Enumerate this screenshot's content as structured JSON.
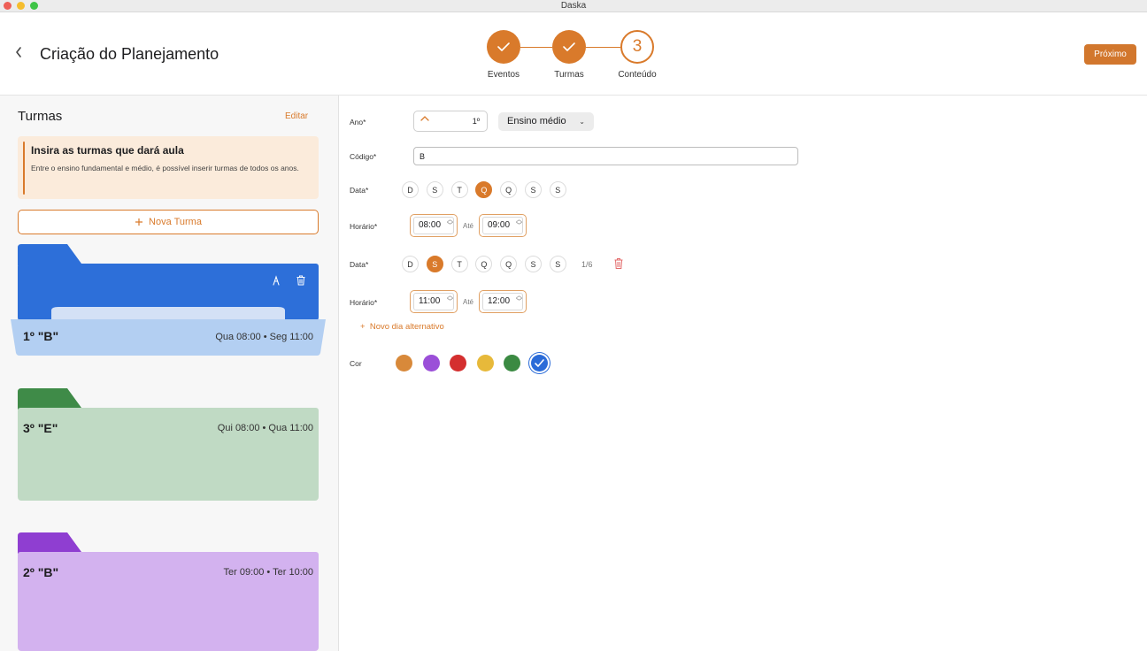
{
  "window": {
    "title": "Daska"
  },
  "header": {
    "back_icon": "chevron-left-icon",
    "title": "Criação do Planejamento",
    "steps": [
      {
        "label": "Eventos",
        "status": "done",
        "icon": "check-icon"
      },
      {
        "label": "Turmas",
        "status": "done",
        "icon": "check-icon"
      },
      {
        "label": "Conteúdo",
        "status": "current",
        "number": "3"
      }
    ],
    "next_label": "Próximo"
  },
  "sidebar": {
    "title": "Turmas",
    "edit_label": "Editar",
    "info": {
      "title": "Insira as turmas que dará aula",
      "text": "Entre o ensino fundamental e médio, é possível inserir turmas de todos os anos."
    },
    "new_class_label": "Nova Turma",
    "classes": [
      {
        "name": "1º \"B\"",
        "schedule": "Qua 08:00 • Seg 11:00",
        "color": "#2d6fd9",
        "state": "open"
      },
      {
        "name": "3º \"E\"",
        "schedule": "Qui 08:00 • Qua 11:00",
        "color": "#3f8b48"
      },
      {
        "name": "2º \"B\"",
        "schedule": "Ter 09:00 • Ter 10:00",
        "color": "#8f3ed1"
      }
    ]
  },
  "form": {
    "year_label": "Ano*",
    "year_value": "1º",
    "level_value": "Ensino médio",
    "code_label": "Código*",
    "code_value": "B",
    "schedules": [
      {
        "date_label": "Data*",
        "days": [
          "D",
          "S",
          "T",
          "Q",
          "Q",
          "S",
          "S"
        ],
        "selected_index": 3,
        "time_label": "Horário*",
        "start": "08:00",
        "until_label": "Até",
        "end": "09:00"
      },
      {
        "date_label": "Data*",
        "days": [
          "D",
          "S",
          "T",
          "Q",
          "Q",
          "S",
          "S"
        ],
        "selected_index": 1,
        "count": "1/6",
        "time_label": "Horário*",
        "start": "11:00",
        "until_label": "Até",
        "end": "12:00"
      }
    ],
    "alt_day_label": "Novo dia alternativo",
    "color_label": "Cor",
    "colors": [
      "#d8893a",
      "#9b4fd8",
      "#d42f2f",
      "#e7b93a",
      "#3b8a42",
      "#2a6bd8"
    ],
    "selected_color_index": 5
  }
}
